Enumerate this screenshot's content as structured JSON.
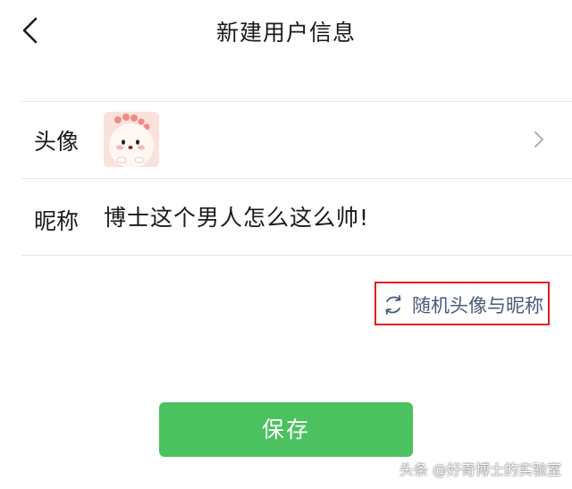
{
  "header": {
    "title": "新建用户信息",
    "back_icon": "chevron-left-icon"
  },
  "avatar_row": {
    "label": "头像",
    "avatar_icon": "cute-dinosaur-avatar",
    "chevron_icon": "chevron-right-icon"
  },
  "nickname_row": {
    "label": "昵称",
    "value": "博士这个男人怎么这么帅!"
  },
  "random": {
    "label": "随机头像与昵称",
    "icon": "refresh-icon",
    "highlight_color": "#e02020",
    "text_color": "#4a5a7a"
  },
  "save_button": {
    "label": "保存",
    "color": "#4cc15f"
  },
  "watermark": {
    "text": "头条 @好奇博士的实验室"
  }
}
